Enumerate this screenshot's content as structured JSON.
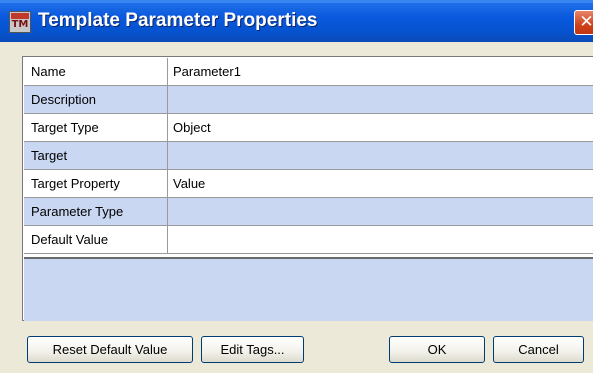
{
  "window": {
    "title": "Template Parameter Properties",
    "app_icon_text": "TM",
    "close_glyph": "✕"
  },
  "properties": [
    {
      "label": "Name",
      "value": "Parameter1"
    },
    {
      "label": "Description",
      "value": ""
    },
    {
      "label": "Target Type",
      "value": "Object"
    },
    {
      "label": "Target",
      "value": ""
    },
    {
      "label": "Target Property",
      "value": "Value"
    },
    {
      "label": "Parameter Type",
      "value": ""
    },
    {
      "label": "Default Value",
      "value": ""
    }
  ],
  "buttons": {
    "reset_default": "Reset Default Value",
    "edit_tags": "Edit Tags...",
    "ok": "OK",
    "cancel": "Cancel"
  },
  "colors": {
    "title_bar": "#0a59de",
    "row_alt": "#c9d7f2",
    "window_bg": "#ece9d8",
    "close_button": "#d0421b"
  }
}
